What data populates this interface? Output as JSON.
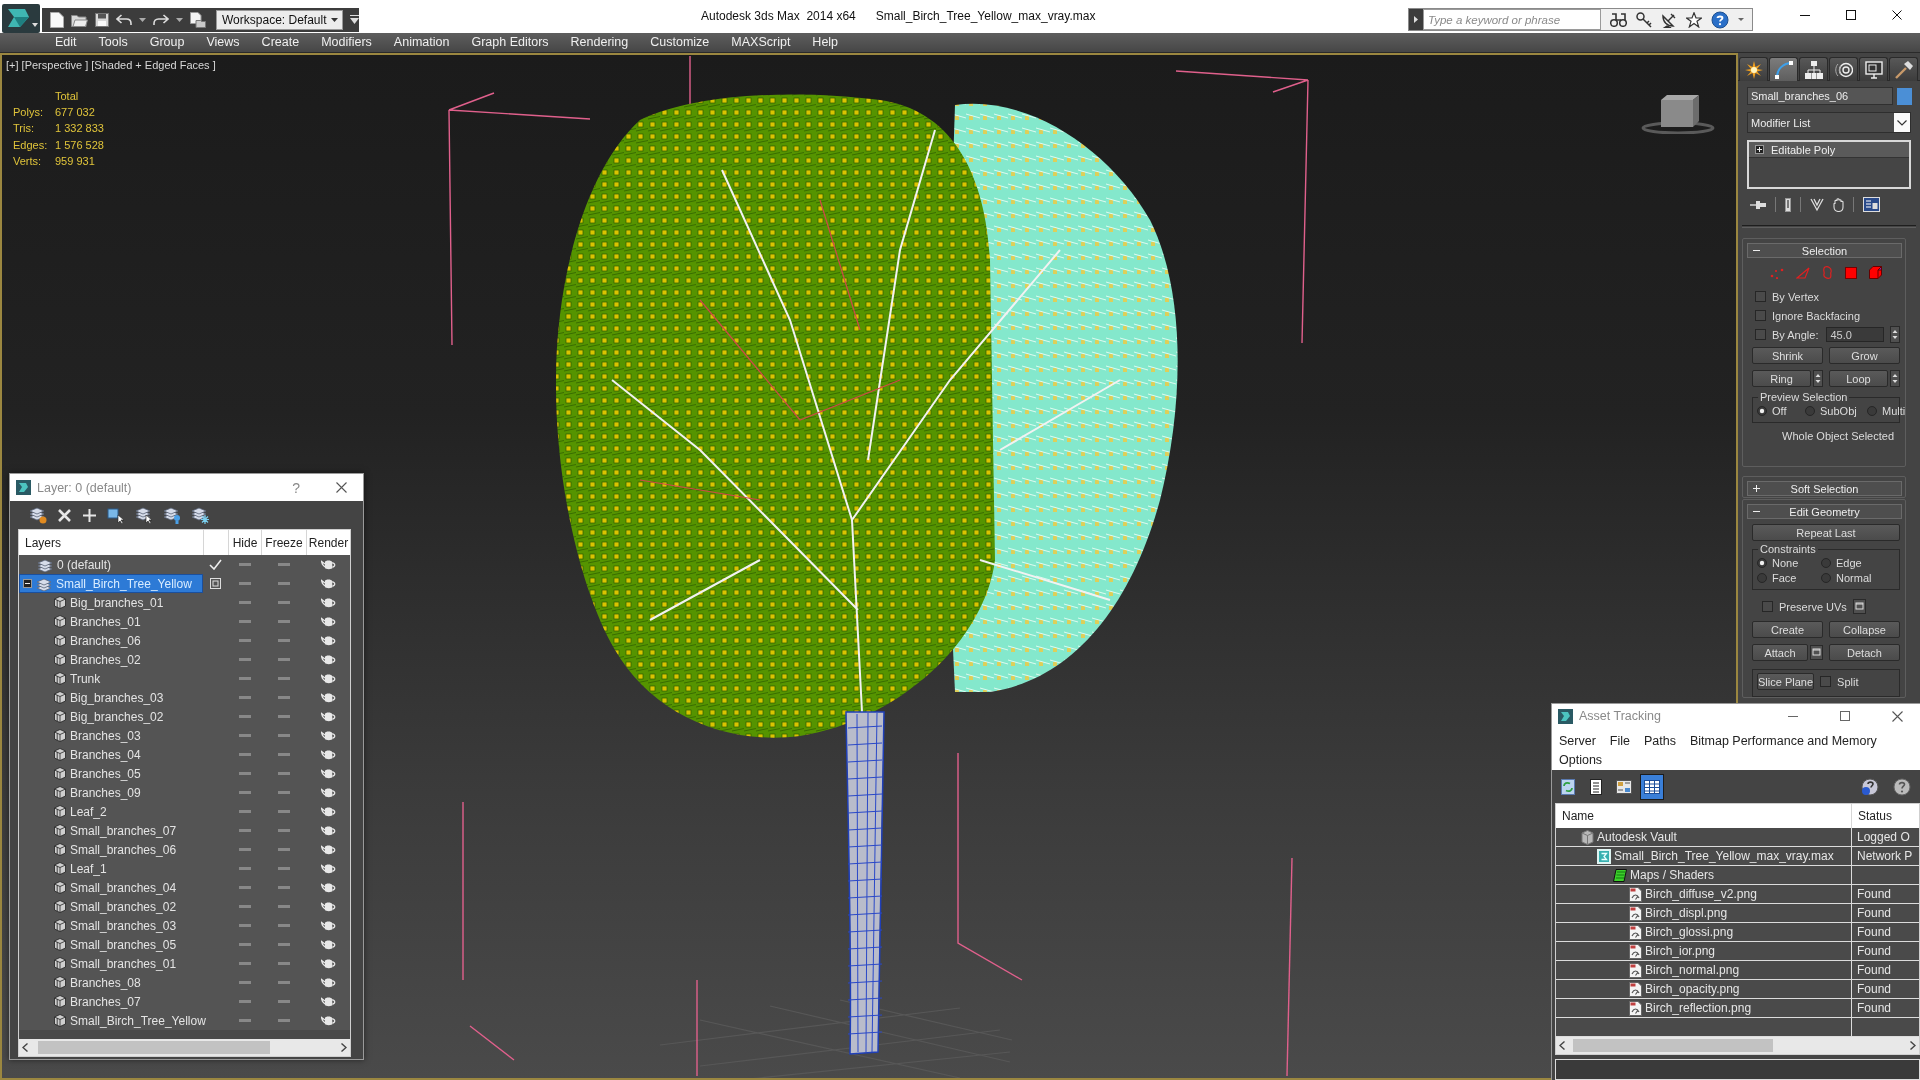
{
  "title_bar": {
    "workspace": "Workspace: Default",
    "app_title": "Autodesk 3ds Max  2014 x64",
    "file_name": "Small_Birch_Tree_Yellow_max_vray.max",
    "search_placeholder": "Type a keyword or phrase"
  },
  "menu_bar": [
    "Edit",
    "Tools",
    "Group",
    "Views",
    "Create",
    "Modifiers",
    "Animation",
    "Graph Editors",
    "Rendering",
    "Customize",
    "MAXScript",
    "Help"
  ],
  "viewport": {
    "label": "[+] [Perspective ] [Shaded + Edged Faces ]",
    "stats_heading": "Total",
    "stats": [
      {
        "label": "Polys:",
        "value": "677 032"
      },
      {
        "label": "Tris:",
        "value": "1 332 833"
      },
      {
        "label": "Edges:",
        "value": "1 576 528"
      },
      {
        "label": "Verts:",
        "value": "959 931"
      }
    ]
  },
  "layer_dialog": {
    "title": "Layer: 0 (default)",
    "help": "?",
    "columns": [
      "Layers",
      "Hide",
      "Freeze",
      "Render"
    ],
    "layers": [
      {
        "name": "0 (default)",
        "selected": false,
        "current": true,
        "expanded": false
      },
      {
        "name": "Small_Birch_Tree_Yellow",
        "selected": true,
        "current": false,
        "expanded": true,
        "children": [
          {
            "name": "Big_branches_01",
            "selected": false
          },
          {
            "name": "Branches_01",
            "selected": false
          },
          {
            "name": "Branches_06",
            "selected": false
          },
          {
            "name": "Branches_02",
            "selected": false
          },
          {
            "name": "Trunk",
            "selected": false
          },
          {
            "name": "Big_branches_03",
            "selected": false
          },
          {
            "name": "Big_branches_02",
            "selected": false
          },
          {
            "name": "Branches_03",
            "selected": false
          },
          {
            "name": "Branches_04",
            "selected": false
          },
          {
            "name": "Branches_05",
            "selected": false
          },
          {
            "name": "Branches_09",
            "selected": false
          },
          {
            "name": "Leaf_2",
            "selected": false
          },
          {
            "name": "Small_branches_07",
            "selected": false
          },
          {
            "name": "Small_branches_06",
            "selected": false
          },
          {
            "name": "Leaf_1",
            "selected": false
          },
          {
            "name": "Small_branches_04",
            "selected": false
          },
          {
            "name": "Small_branches_02",
            "selected": false
          },
          {
            "name": "Small_branches_03",
            "selected": false
          },
          {
            "name": "Small_branches_05",
            "selected": false
          },
          {
            "name": "Small_branches_01",
            "selected": false
          },
          {
            "name": "Branches_08",
            "selected": false
          },
          {
            "name": "Branches_07",
            "selected": false
          },
          {
            "name": "Small_Birch_Tree_Yellow",
            "selected": false
          }
        ]
      }
    ]
  },
  "command_panel": {
    "tabs": [
      {
        "kind": "create",
        "selected": false
      },
      {
        "kind": "modify",
        "selected": true
      },
      {
        "kind": "hierarchy",
        "selected": false
      },
      {
        "kind": "motion",
        "selected": false
      },
      {
        "kind": "display",
        "selected": false
      },
      {
        "kind": "utilities",
        "selected": false
      }
    ],
    "object": {
      "name": "Small_branches_06",
      "color": "#4b8fd6"
    },
    "modifier_list": "Modifier List",
    "stack": [
      {
        "name": "Editable Poly",
        "expanded": false
      }
    ],
    "selection_rollout": {
      "title": "Selection",
      "expanded": true,
      "checkboxes": [
        {
          "label": "By Vertex",
          "checked": false
        },
        {
          "label": "Ignore Backfacing",
          "checked": false
        },
        {
          "label": "By Angle:",
          "checked": false,
          "value": "45.0"
        }
      ],
      "buttons": [
        {
          "label": "Shrink",
          "kind": "plain"
        },
        {
          "label": "Grow",
          "kind": "plain"
        },
        {
          "label": "Ring",
          "kind": "spinner"
        },
        {
          "label": "Loop",
          "kind": "spinner"
        }
      ],
      "preview_label": "Preview Selection",
      "preview_options": [
        {
          "label": "Off",
          "selected": true
        },
        {
          "label": "SubObj",
          "selected": false
        },
        {
          "label": "Multi",
          "selected": false
        }
      ],
      "status": "Whole Object Selected"
    },
    "soft_selection_rollout": {
      "title": "Soft Selection",
      "expanded": false
    },
    "edit_geometry_rollout": {
      "title": "Edit Geometry",
      "expanded": true,
      "repeat_button": "Repeat Last",
      "constraints_label": "Constraints",
      "constraints": [
        {
          "label": "None",
          "selected": true
        },
        {
          "label": "Edge",
          "selected": false
        },
        {
          "label": "Face",
          "selected": false
        },
        {
          "label": "Normal",
          "selected": false
        }
      ],
      "preserve_uvs": {
        "label": "Preserve UVs",
        "checked": false
      },
      "buttons": [
        {
          "label": "Create",
          "kind": "plain"
        },
        {
          "label": "Collapse",
          "kind": "plain"
        },
        {
          "label": "Attach",
          "kind": "settings"
        },
        {
          "label": "Detach",
          "kind": "plain"
        }
      ],
      "slice_plane": "Slice Plane",
      "split": {
        "label": "Split",
        "checked": false
      }
    }
  },
  "asset_tracking": {
    "title": "Asset Tracking",
    "menu": [
      "Server",
      "File",
      "Paths",
      "Bitmap Performance and Memory",
      "Options"
    ],
    "view_buttons": [
      {
        "kind": "refresh",
        "selected": false
      },
      {
        "kind": "list",
        "selected": false
      },
      {
        "kind": "thumbnails",
        "selected": false
      },
      {
        "kind": "table",
        "selected": true
      }
    ],
    "columns": [
      "Name",
      "Status"
    ],
    "assets": [
      {
        "kind": "vault",
        "name": "Autodesk Vault",
        "status": "Logged O",
        "children": [
          {
            "kind": "scene",
            "name": "Small_Birch_Tree_Yellow_max_vray.max",
            "status": "Network P",
            "children": [
              {
                "kind": "folder",
                "name": "Maps / Shaders",
                "children": [
                  {
                    "kind": "bitmap",
                    "name": "Birch_diffuse_v2.png",
                    "status": "Found"
                  },
                  {
                    "kind": "bitmap",
                    "name": "Birch_displ.png",
                    "status": "Found"
                  },
                  {
                    "kind": "bitmap",
                    "name": "Birch_glossi.png",
                    "status": "Found"
                  },
                  {
                    "kind": "bitmap",
                    "name": "Birch_ior.png",
                    "status": "Found"
                  },
                  {
                    "kind": "bitmap",
                    "name": "Birch_normal.png",
                    "status": "Found"
                  },
                  {
                    "kind": "bitmap",
                    "name": "Birch_opacity.png",
                    "status": "Found"
                  },
                  {
                    "kind": "bitmap",
                    "name": "Birch_reflection.png",
                    "status": "Found"
                  }
                ]
              }
            ]
          }
        ]
      }
    ]
  }
}
